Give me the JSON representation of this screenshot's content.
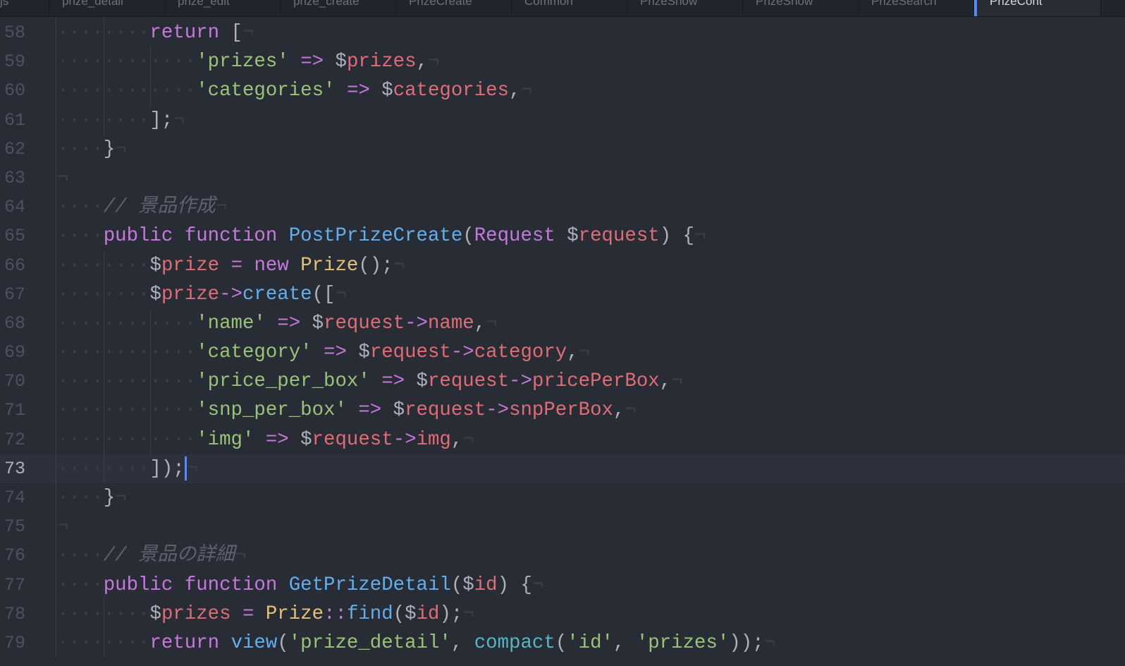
{
  "tabs": [
    {
      "label": "js"
    },
    {
      "label": "prize_detail"
    },
    {
      "label": "prize_edit"
    },
    {
      "label": "prize_create"
    },
    {
      "label": "PrizeCreate"
    },
    {
      "label": "Common"
    },
    {
      "label": "PrizeShow"
    },
    {
      "label": "PrizeShow"
    },
    {
      "label": "PrizeSearch"
    },
    {
      "label": "PrizeCont",
      "active": true
    }
  ],
  "current_line": 73,
  "lines": [
    {
      "n": 58,
      "indent": 8,
      "t": [
        [
          "kw",
          "return"
        ],
        [
          "p",
          " ["
        ]
      ]
    },
    {
      "n": 59,
      "indent": 12,
      "t": [
        [
          "str",
          "'prizes'"
        ],
        [
          "p",
          " "
        ],
        [
          "op",
          "=>"
        ],
        [
          "p",
          " $"
        ],
        [
          "var",
          "prizes"
        ],
        [
          "p",
          ","
        ]
      ]
    },
    {
      "n": 60,
      "indent": 12,
      "t": [
        [
          "str",
          "'categories'"
        ],
        [
          "p",
          " "
        ],
        [
          "op",
          "=>"
        ],
        [
          "p",
          " $"
        ],
        [
          "var",
          "categories"
        ],
        [
          "p",
          ","
        ]
      ]
    },
    {
      "n": 61,
      "indent": 8,
      "t": [
        [
          "p",
          "];"
        ]
      ]
    },
    {
      "n": 62,
      "indent": 4,
      "t": [
        [
          "p",
          "}"
        ]
      ]
    },
    {
      "n": 63,
      "indent": 0,
      "t": []
    },
    {
      "n": 64,
      "indent": 4,
      "t": [
        [
          "cm",
          "// 景品作成"
        ]
      ]
    },
    {
      "n": 65,
      "indent": 4,
      "t": [
        [
          "kw",
          "public"
        ],
        [
          "p",
          " "
        ],
        [
          "kw",
          "function"
        ],
        [
          "p",
          " "
        ],
        [
          "fn",
          "PostPrizeCreate"
        ],
        [
          "p",
          "("
        ],
        [
          "kw",
          "Request"
        ],
        [
          "p",
          " $"
        ],
        [
          "var",
          "request"
        ],
        [
          "p",
          ") {"
        ]
      ]
    },
    {
      "n": 66,
      "indent": 8,
      "t": [
        [
          "p",
          "$"
        ],
        [
          "var",
          "prize"
        ],
        [
          "p",
          " "
        ],
        [
          "op",
          "="
        ],
        [
          "p",
          " "
        ],
        [
          "kw",
          "new"
        ],
        [
          "p",
          " "
        ],
        [
          "cls",
          "Prize"
        ],
        [
          "p",
          "();"
        ]
      ]
    },
    {
      "n": 67,
      "indent": 8,
      "t": [
        [
          "p",
          "$"
        ],
        [
          "var",
          "prize"
        ],
        [
          "op",
          "->"
        ],
        [
          "fn",
          "create"
        ],
        [
          "p",
          "(["
        ]
      ]
    },
    {
      "n": 68,
      "indent": 12,
      "t": [
        [
          "str",
          "'name'"
        ],
        [
          "p",
          " "
        ],
        [
          "op",
          "=>"
        ],
        [
          "p",
          " $"
        ],
        [
          "var",
          "request"
        ],
        [
          "op",
          "->"
        ],
        [
          "var",
          "name"
        ],
        [
          "p",
          ","
        ]
      ]
    },
    {
      "n": 69,
      "indent": 12,
      "t": [
        [
          "str",
          "'category'"
        ],
        [
          "p",
          " "
        ],
        [
          "op",
          "=>"
        ],
        [
          "p",
          " $"
        ],
        [
          "var",
          "request"
        ],
        [
          "op",
          "->"
        ],
        [
          "var",
          "category"
        ],
        [
          "p",
          ","
        ]
      ]
    },
    {
      "n": 70,
      "indent": 12,
      "t": [
        [
          "str",
          "'price_per_box'"
        ],
        [
          "p",
          " "
        ],
        [
          "op",
          "=>"
        ],
        [
          "p",
          " $"
        ],
        [
          "var",
          "request"
        ],
        [
          "op",
          "->"
        ],
        [
          "var",
          "pricePerBox"
        ],
        [
          "p",
          ","
        ]
      ]
    },
    {
      "n": 71,
      "indent": 12,
      "t": [
        [
          "str",
          "'snp_per_box'"
        ],
        [
          "p",
          " "
        ],
        [
          "op",
          "=>"
        ],
        [
          "p",
          " $"
        ],
        [
          "var",
          "request"
        ],
        [
          "op",
          "->"
        ],
        [
          "var",
          "snpPerBox"
        ],
        [
          "p",
          ","
        ]
      ]
    },
    {
      "n": 72,
      "indent": 12,
      "t": [
        [
          "str",
          "'img'"
        ],
        [
          "p",
          " "
        ],
        [
          "op",
          "=>"
        ],
        [
          "p",
          " $"
        ],
        [
          "var",
          "request"
        ],
        [
          "op",
          "->"
        ],
        [
          "var",
          "img"
        ],
        [
          "p",
          ","
        ]
      ]
    },
    {
      "n": 73,
      "indent": 8,
      "t": [
        [
          "p",
          "]);"
        ]
      ]
    },
    {
      "n": 74,
      "indent": 4,
      "t": [
        [
          "p",
          "}"
        ]
      ]
    },
    {
      "n": 75,
      "indent": 0,
      "t": []
    },
    {
      "n": 76,
      "indent": 4,
      "t": [
        [
          "cm",
          "// 景品の詳細"
        ]
      ]
    },
    {
      "n": 77,
      "indent": 4,
      "t": [
        [
          "kw",
          "public"
        ],
        [
          "p",
          " "
        ],
        [
          "kw",
          "function"
        ],
        [
          "p",
          " "
        ],
        [
          "fn",
          "GetPrizeDetail"
        ],
        [
          "p",
          "($"
        ],
        [
          "var",
          "id"
        ],
        [
          "p",
          ") {"
        ]
      ]
    },
    {
      "n": 78,
      "indent": 8,
      "t": [
        [
          "p",
          "$"
        ],
        [
          "var",
          "prizes"
        ],
        [
          "p",
          " "
        ],
        [
          "op",
          "="
        ],
        [
          "p",
          " "
        ],
        [
          "cls",
          "Prize"
        ],
        [
          "op",
          "::"
        ],
        [
          "fn",
          "find"
        ],
        [
          "p",
          "($"
        ],
        [
          "var",
          "id"
        ],
        [
          "p",
          ");"
        ]
      ]
    },
    {
      "n": 79,
      "indent": 8,
      "t": [
        [
          "kw",
          "return"
        ],
        [
          "p",
          " "
        ],
        [
          "fn",
          "view"
        ],
        [
          "p",
          "("
        ],
        [
          "str",
          "'prize_detail'"
        ],
        [
          "p",
          ", "
        ],
        [
          "bi",
          "compact"
        ],
        [
          "p",
          "("
        ],
        [
          "str",
          "'id'"
        ],
        [
          "p",
          ", "
        ],
        [
          "str",
          "'prizes'"
        ],
        [
          "p",
          "));"
        ]
      ]
    }
  ],
  "eol_marker": "¬",
  "indent_marker": "·"
}
